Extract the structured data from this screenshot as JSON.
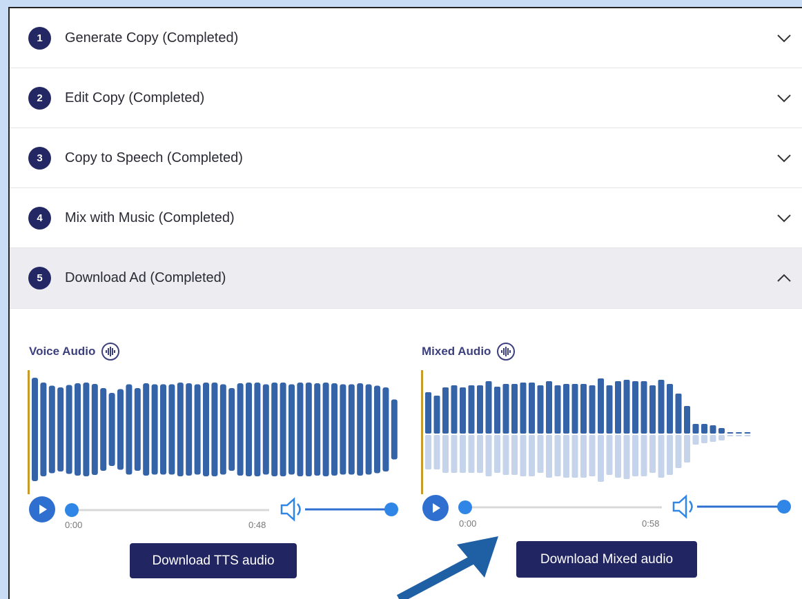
{
  "steps": [
    {
      "number": "1",
      "label": "Generate Copy (Completed)",
      "expanded": false
    },
    {
      "number": "2",
      "label": "Edit Copy (Completed)",
      "expanded": false
    },
    {
      "number": "3",
      "label": "Copy to Speech (Completed)",
      "expanded": false
    },
    {
      "number": "4",
      "label": "Mix with Music (Completed)",
      "expanded": false
    },
    {
      "number": "5",
      "label": "Download Ad (Completed)",
      "expanded": true
    }
  ],
  "voice": {
    "title": "Voice Audio",
    "start_time": "0:00",
    "end_time": "0:48",
    "download_label": "Download TTS audio",
    "volume": 1.0,
    "progress": 0.0
  },
  "mixed": {
    "title": "Mixed Audio",
    "start_time": "0:00",
    "end_time": "0:58",
    "download_label": "Download Mixed audio",
    "volume": 1.0,
    "progress": 0.0
  },
  "colors": {
    "accent": "#232763",
    "wave": "#3563a8",
    "wave_light": "#c5d4ea",
    "cursor": "#c89a2a",
    "control": "#2f7de0"
  }
}
